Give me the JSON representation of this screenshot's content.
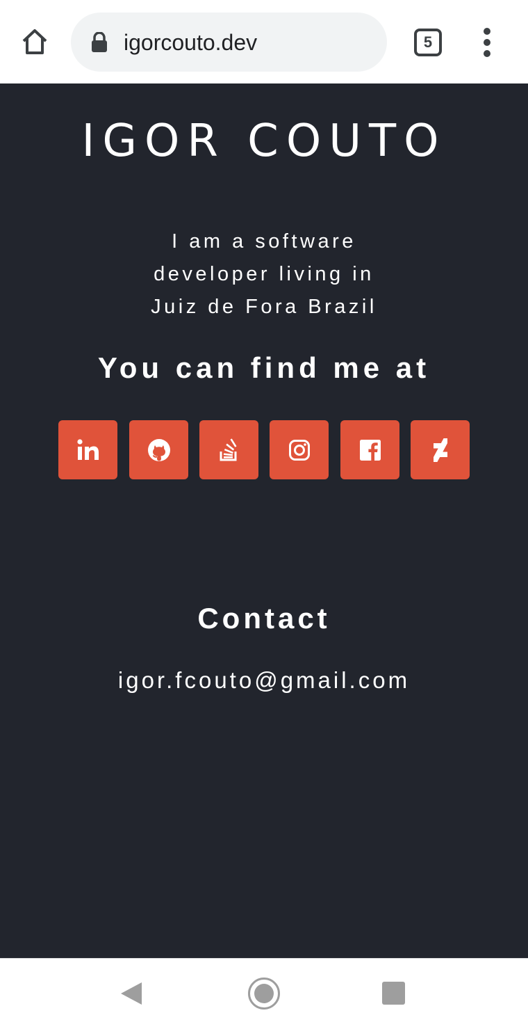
{
  "browser": {
    "url": "igorcouto.dev",
    "tab_count": "5",
    "home_icon": "home-icon",
    "lock_icon": "lock-icon",
    "menu_icon": "more-vertical-icon"
  },
  "page": {
    "title": "IGOR COUTO",
    "bio_lines": [
      "I am a software",
      "developer living in",
      "Juiz de Fora Brazil"
    ],
    "find_heading": "You can find me at",
    "socials": [
      {
        "name": "linkedin",
        "icon": "linkedin-icon"
      },
      {
        "name": "github",
        "icon": "github-icon"
      },
      {
        "name": "stackoverflow",
        "icon": "stackoverflow-icon"
      },
      {
        "name": "instagram",
        "icon": "instagram-icon"
      },
      {
        "name": "facebook",
        "icon": "facebook-icon"
      },
      {
        "name": "deviantart",
        "icon": "deviantart-icon"
      }
    ],
    "contact_heading": "Contact",
    "contact_email": "igor.fcouto@gmail.com"
  },
  "colors": {
    "background": "#22252d",
    "accent": "#e0533a",
    "text": "#ffffff"
  },
  "navbar": {
    "back_icon": "back-triangle-icon",
    "home_icon": "home-circle-icon",
    "recents_icon": "recents-square-icon"
  }
}
